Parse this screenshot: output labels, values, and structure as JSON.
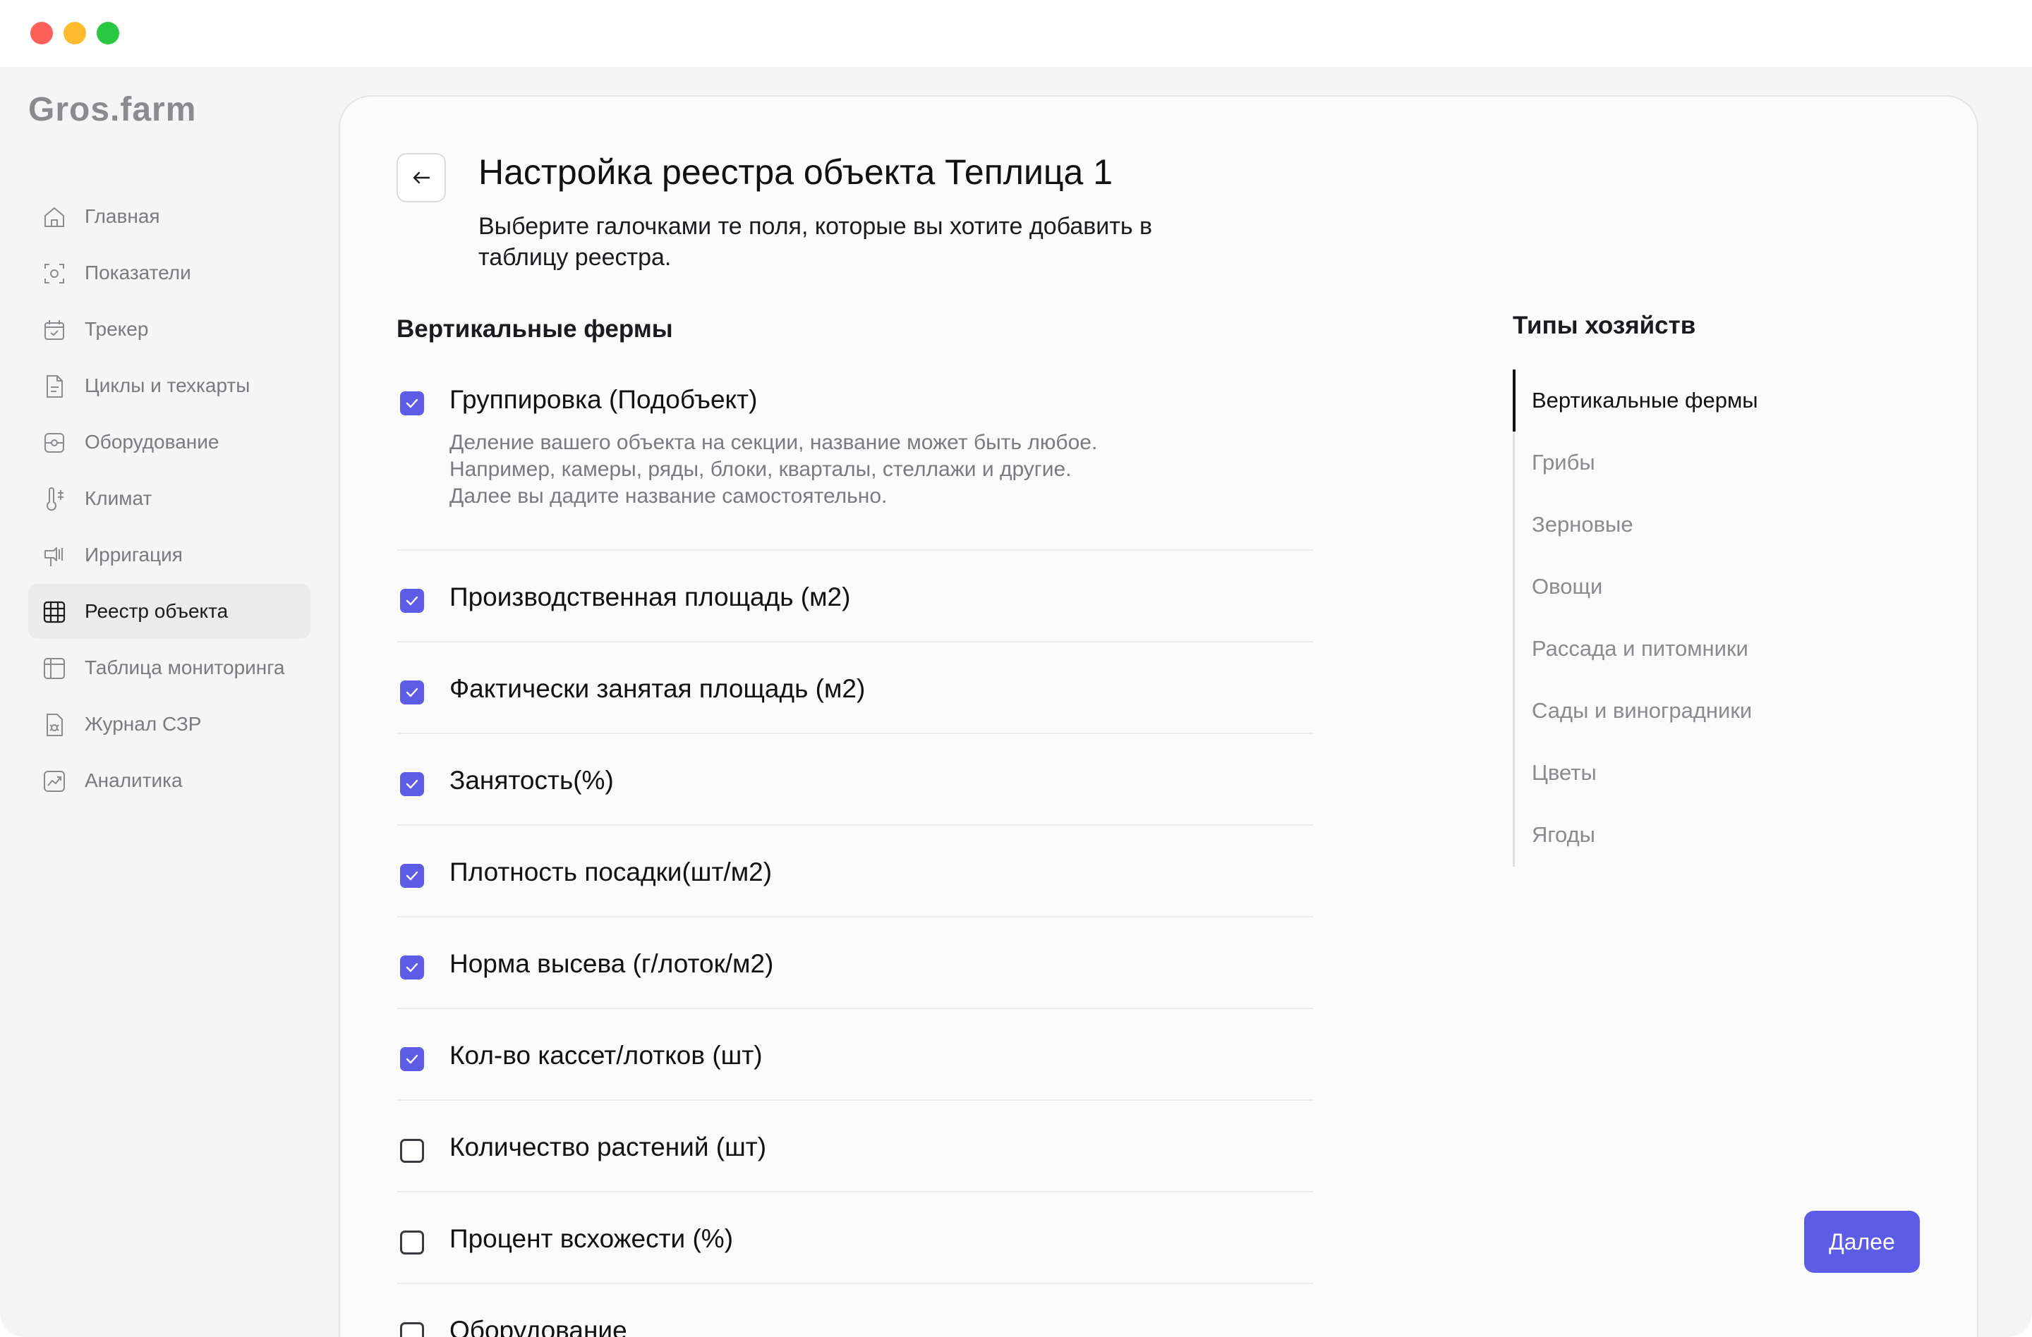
{
  "window": {
    "buttons": [
      "close",
      "minimize",
      "maximize"
    ]
  },
  "logo": "Gros.farm",
  "sidebar": {
    "items": [
      {
        "label": "Главная",
        "icon": "home-icon"
      },
      {
        "label": "Показатели",
        "icon": "indicators-icon"
      },
      {
        "label": "Трекер",
        "icon": "calendar-icon"
      },
      {
        "label": "Циклы и техкарты",
        "icon": "document-icon"
      },
      {
        "label": "Оборудование",
        "icon": "equipment-icon"
      },
      {
        "label": "Климат",
        "icon": "thermometer-icon"
      },
      {
        "label": "Ирригация",
        "icon": "irrigation-icon"
      },
      {
        "label": "Реестр объекта",
        "icon": "grid-icon",
        "active": true
      },
      {
        "label": "Таблица мониторинга",
        "icon": "table-icon"
      },
      {
        "label": "Журнал СЗР",
        "icon": "journal-icon"
      },
      {
        "label": "Аналитика",
        "icon": "analytics-icon"
      }
    ]
  },
  "main": {
    "title": "Настройка реестра объекта Теплица 1",
    "subtitle": "Выберите галочками те поля, которые вы хотите добавить в таблицу реестра.",
    "section_title": "Вертикальные фермы",
    "fields": [
      {
        "label": "Группировка (Подобъект)",
        "checked": true,
        "description": [
          "Деление вашего объекта на секции, название может быть любое.",
          "Например, камеры, ряды, блоки, кварталы, стеллажи и другие.",
          "Далее вы дадите название самостоятельно."
        ]
      },
      {
        "label": "Производственная площадь (м2)",
        "checked": true
      },
      {
        "label": "Фактически занятая площадь (м2)",
        "checked": true
      },
      {
        "label": "Занятость(%)",
        "checked": true
      },
      {
        "label": "Плотность посадки(шт/м2)",
        "checked": true
      },
      {
        "label": "Норма высева (г/лоток/м2)",
        "checked": true
      },
      {
        "label": "Кол-во кассет/лотков (шт)",
        "checked": true
      },
      {
        "label": "Количество растений (шт)",
        "checked": false
      },
      {
        "label": "Процент всхожести (%)",
        "checked": false
      },
      {
        "label": "Оборудование",
        "checked": false
      }
    ],
    "next_label": "Далее"
  },
  "types": {
    "title": "Типы хозяйств",
    "items": [
      {
        "label": "Вертикальные фермы",
        "active": true
      },
      {
        "label": "Грибы"
      },
      {
        "label": "Зерновые"
      },
      {
        "label": "Овощи"
      },
      {
        "label": "Рассада и питомники"
      },
      {
        "label": "Сады и виноградники"
      },
      {
        "label": "Цветы"
      },
      {
        "label": "Ягоды"
      }
    ]
  },
  "colors": {
    "accent": "#5d5ce6",
    "background": "#f5f5f5",
    "card": "#fbfbfb",
    "muted_text": "#7a7a80"
  }
}
